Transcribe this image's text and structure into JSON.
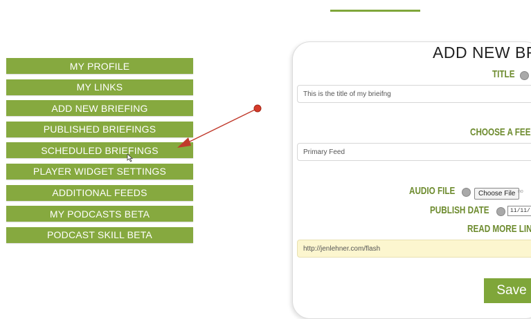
{
  "menu": {
    "items": [
      {
        "label": "MY PROFILE"
      },
      {
        "label": "MY LINKS"
      },
      {
        "label": "ADD NEW BRIEFING"
      },
      {
        "label": "PUBLISHED BRIEFINGS"
      },
      {
        "label": "SCHEDULED BRIEFINGS"
      },
      {
        "label": "PLAYER WIDGET SETTINGS"
      },
      {
        "label": "ADDITIONAL FEEDS"
      },
      {
        "label": "MY PODCASTS BETA"
      },
      {
        "label": "PODCAST SKILL BETA"
      }
    ]
  },
  "form": {
    "title": "ADD NEW BR",
    "title_label": "TITLE",
    "title_value": "This is the title of my brieifng",
    "feed_label": "CHOOSE A FEE",
    "feed_value": "Primary Feed",
    "audio_label": "AUDIO FILE",
    "choose_file_label": "Choose File",
    "no_file_text": "no",
    "publish_label": "PUBLISH DATE",
    "publish_value": "11/11/",
    "read_more_label": "READ MORE LIN",
    "read_more_value": "http://jenlehner.com/flash",
    "save_label": "Save"
  },
  "colors": {
    "accent": "#86a93f",
    "label": "#6d8b2e",
    "annotation": "#c0392b"
  }
}
